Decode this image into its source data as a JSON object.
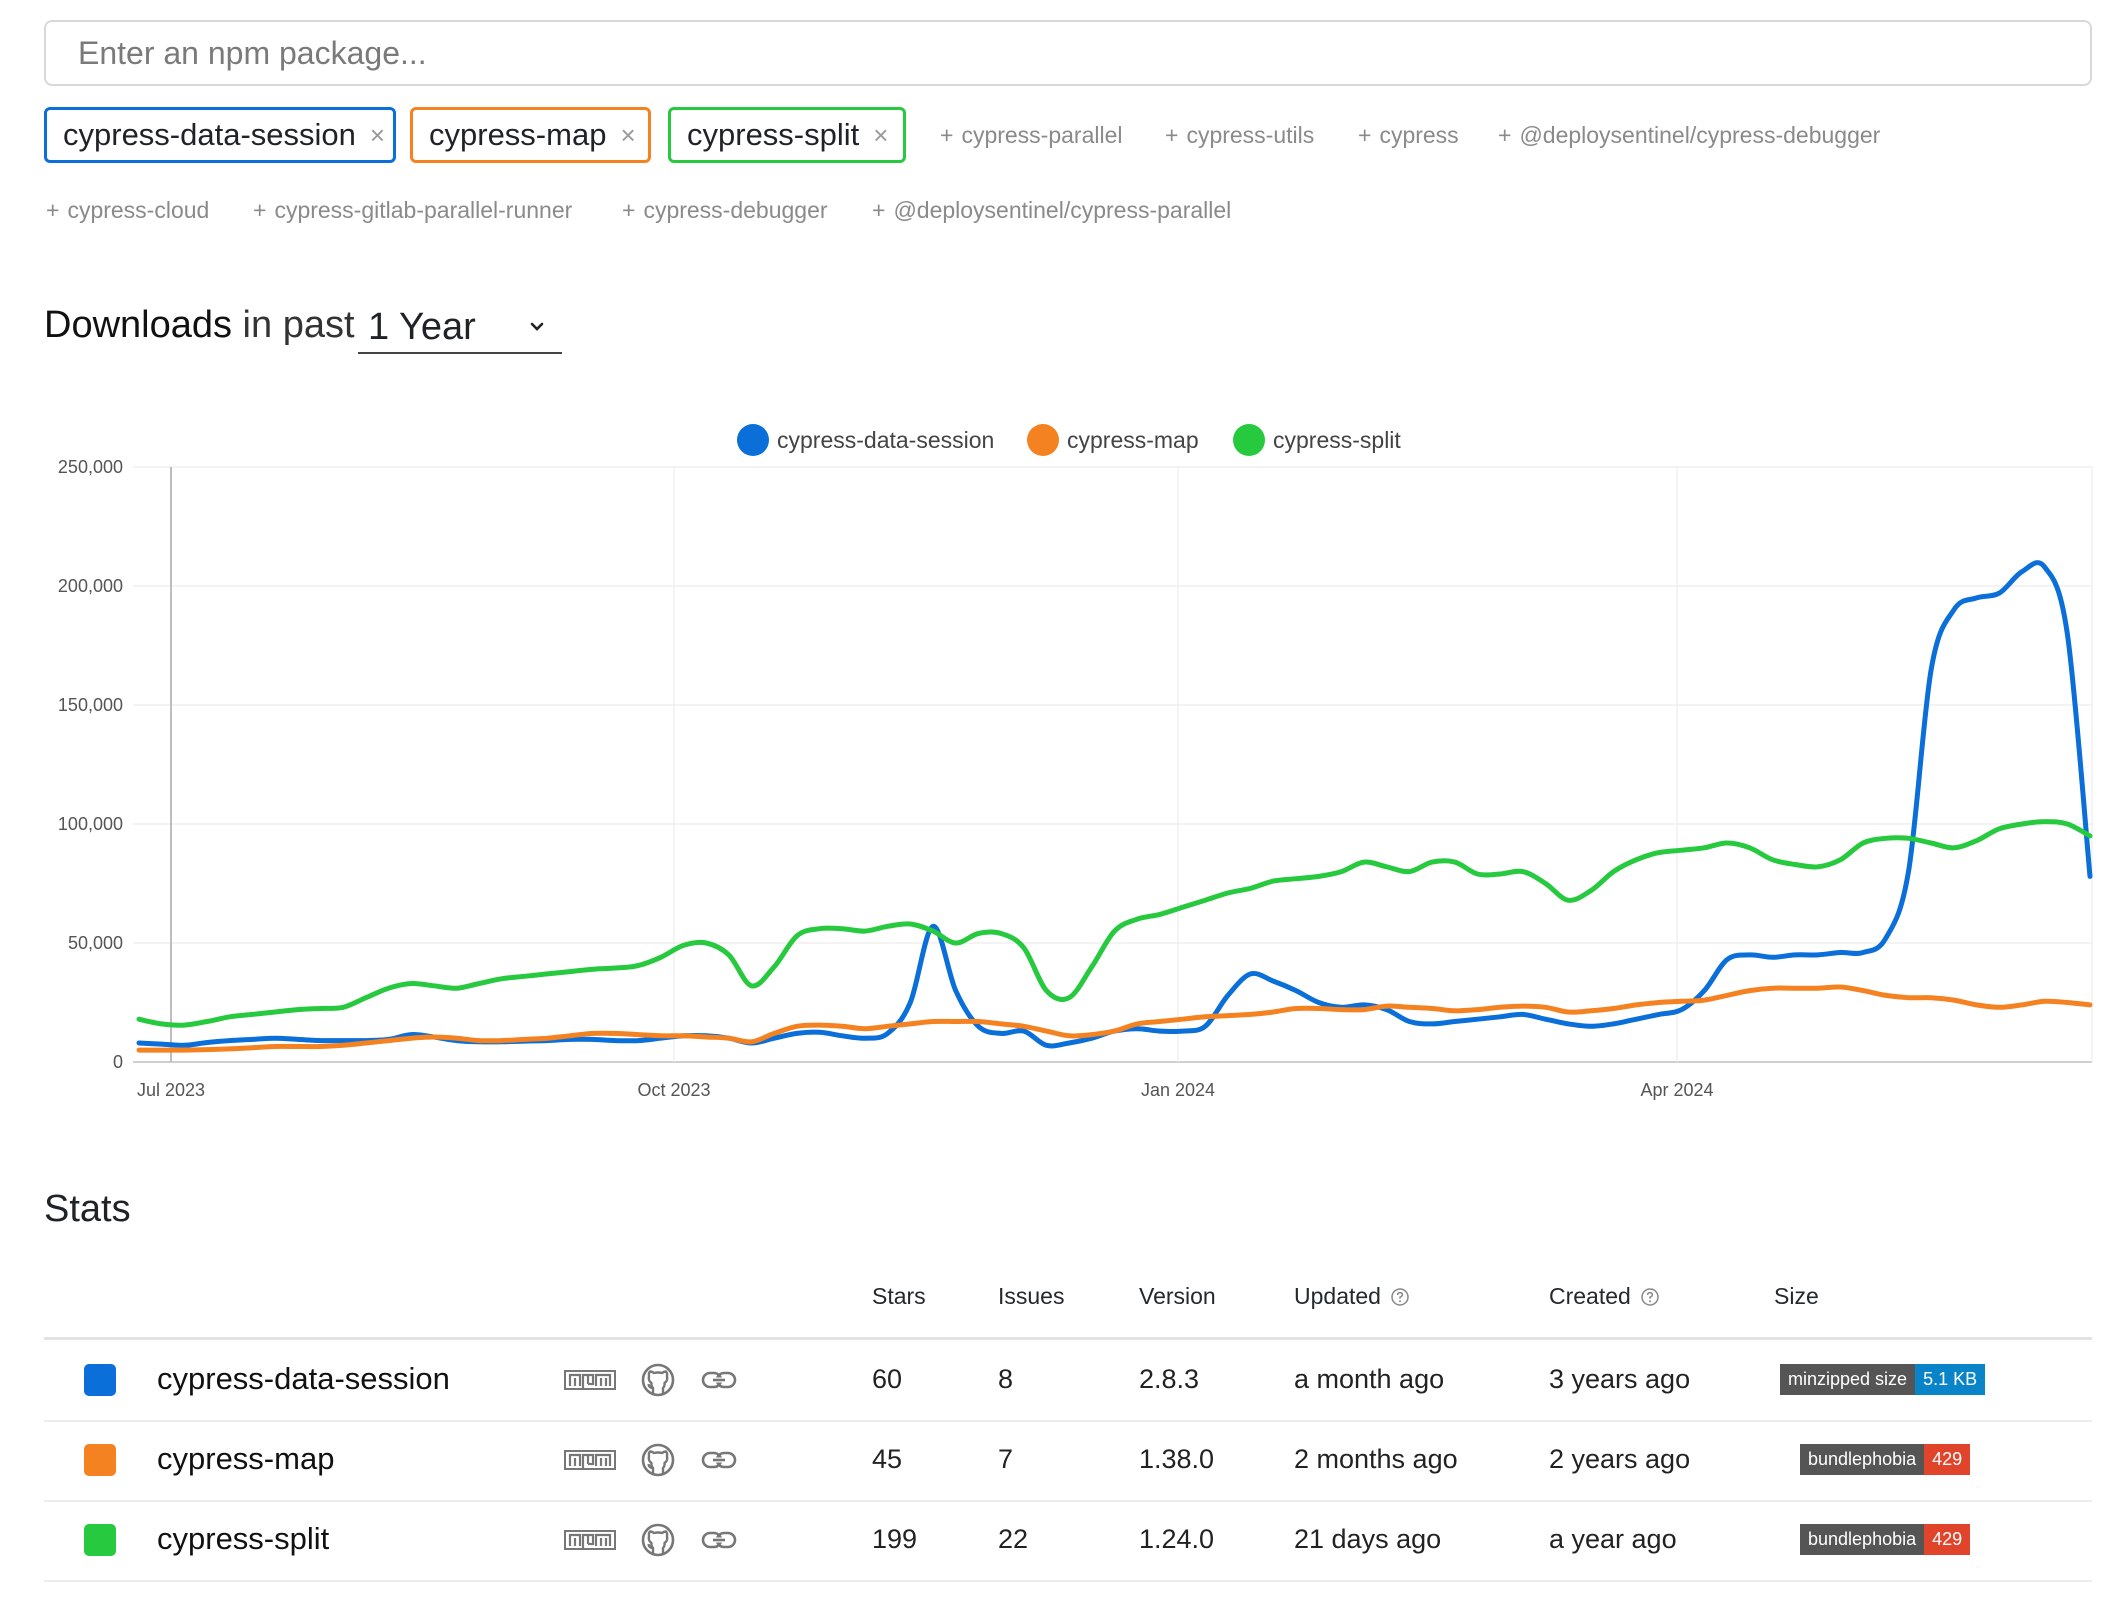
{
  "search": {
    "placeholder": "Enter an npm package..."
  },
  "selected": [
    {
      "name": "cypress-data-session",
      "color": "#0a6fd8"
    },
    {
      "name": "cypress-map",
      "color": "#f58220"
    },
    {
      "name": "cypress-split",
      "color": "#27c93f"
    }
  ],
  "remove_glyph": "×",
  "suggestions_row1": [
    "cypress-parallel",
    "cypress-utils",
    "cypress",
    "@deploysentinel/cypress-debugger"
  ],
  "suggestions_row2": [
    "cypress-cloud",
    "cypress-gitlab-parallel-runner",
    "cypress-debugger",
    "@deploysentinel/cypress-parallel"
  ],
  "suggestion_prefix": "+",
  "downloads": {
    "title_strong": "Downloads",
    "title_rest": " in past",
    "period": "1 Year"
  },
  "chart_data": {
    "type": "line",
    "x_ticks": [
      "Jul 2023",
      "Oct 2023",
      "Jan 2024",
      "Apr 2024"
    ],
    "y_ticks": [
      "0",
      "50,000",
      "100,000",
      "150,000",
      "200,000",
      "250,000"
    ],
    "ylim": [
      0,
      250000
    ],
    "x_start_date": "2023-06-18",
    "legend": [
      "cypress-data-session",
      "cypress-map",
      "cypress-split"
    ],
    "grid": true,
    "legend_position": "top-center",
    "series": [
      {
        "name": "cypress-data-session",
        "color": "#0a6fd8",
        "values": [
          8000,
          7500,
          7000,
          8200,
          9000,
          9500,
          10000,
          9500,
          9000,
          9000,
          9000,
          9500,
          11500,
          10500,
          9000,
          8500,
          8500,
          8800,
          9000,
          9500,
          9500,
          9000,
          9000,
          10000,
          11000,
          11000,
          10000,
          8000,
          10000,
          12000,
          12500,
          11000,
          10000,
          12000,
          25000,
          57000,
          30000,
          15000,
          12000,
          13000,
          7000,
          8000,
          10000,
          13000,
          14000,
          13000,
          13000,
          15000,
          28000,
          37000,
          34000,
          30000,
          25000,
          23000,
          24000,
          22000,
          17000,
          16000,
          17000,
          18000,
          19000,
          20000,
          18000,
          16000,
          15000,
          16000,
          18000,
          20000,
          22000,
          30000,
          43000,
          45000,
          44000,
          45000,
          45000,
          46000,
          46000,
          52000,
          80000,
          165000,
          190000,
          195000,
          197000,
          206000,
          208000,
          180000,
          78000
        ]
      },
      {
        "name": "cypress-map",
        "color": "#f58220",
        "values": [
          5000,
          5000,
          5000,
          5200,
          5500,
          6000,
          6500,
          6500,
          6500,
          7000,
          8000,
          9000,
          10000,
          10500,
          10000,
          9000,
          9000,
          9500,
          10000,
          11000,
          12000,
          12000,
          11500,
          11000,
          11000,
          10500,
          10000,
          8500,
          12000,
          15000,
          15500,
          15000,
          14000,
          15000,
          16000,
          17000,
          17000,
          17000,
          16000,
          15000,
          13000,
          11000,
          11500,
          13000,
          16000,
          17000,
          18000,
          19000,
          19500,
          20000,
          21000,
          22500,
          22500,
          22000,
          22000,
          23500,
          23000,
          22500,
          21500,
          22000,
          23000,
          23500,
          23000,
          21000,
          21500,
          22500,
          24000,
          25000,
          25500,
          26000,
          28000,
          30000,
          31000,
          31000,
          31000,
          31500,
          30000,
          28000,
          27000,
          27000,
          26000,
          24000,
          23000,
          24000,
          25500,
          25000,
          24000
        ]
      },
      {
        "name": "cypress-split",
        "color": "#27c93f",
        "values": [
          18000,
          16000,
          15500,
          17000,
          19000,
          20000,
          21000,
          22000,
          22500,
          23000,
          27000,
          31000,
          33000,
          32000,
          31000,
          33000,
          35000,
          36000,
          37000,
          38000,
          39000,
          39500,
          40500,
          44000,
          49000,
          50000,
          45000,
          32000,
          40000,
          53000,
          56000,
          56000,
          55000,
          57000,
          58000,
          55000,
          50000,
          54000,
          54000,
          48000,
          30000,
          27000,
          40000,
          55000,
          60000,
          62000,
          65000,
          68000,
          71000,
          73000,
          76000,
          77000,
          78000,
          80000,
          84000,
          82000,
          80000,
          84000,
          84000,
          79000,
          79000,
          80000,
          75000,
          68000,
          72000,
          80000,
          85000,
          88000,
          89000,
          90000,
          92000,
          90000,
          85000,
          83000,
          82000,
          85000,
          92000,
          94000,
          94000,
          92000,
          90000,
          93000,
          98000,
          100000,
          101000,
          100000,
          95000
        ]
      }
    ]
  },
  "stats": {
    "title": "Stats",
    "columns": {
      "stars": "Stars",
      "issues": "Issues",
      "version": "Version",
      "updated": "Updated",
      "created": "Created",
      "size": "Size"
    },
    "rows": [
      {
        "name": "cypress-data-session",
        "color": "#0a6fd8",
        "stars": "60",
        "issues": "8",
        "version": "2.8.3",
        "updated": "a month ago",
        "created": "3 years ago",
        "badge": {
          "label": "minzipped size",
          "value": "5.1 KB",
          "value_color": "#0a84c8"
        }
      },
      {
        "name": "cypress-map",
        "color": "#f58220",
        "stars": "45",
        "issues": "7",
        "version": "1.38.0",
        "updated": "2 months ago",
        "created": "2 years ago",
        "badge": {
          "label": "bundlephobia",
          "value": "429",
          "value_color": "#e0452c"
        }
      },
      {
        "name": "cypress-split",
        "color": "#27c93f",
        "stars": "199",
        "issues": "22",
        "version": "1.24.0",
        "updated": "21 days ago",
        "created": "a year ago",
        "badge": {
          "label": "bundlephobia",
          "value": "429",
          "value_color": "#e0452c"
        }
      }
    ]
  }
}
